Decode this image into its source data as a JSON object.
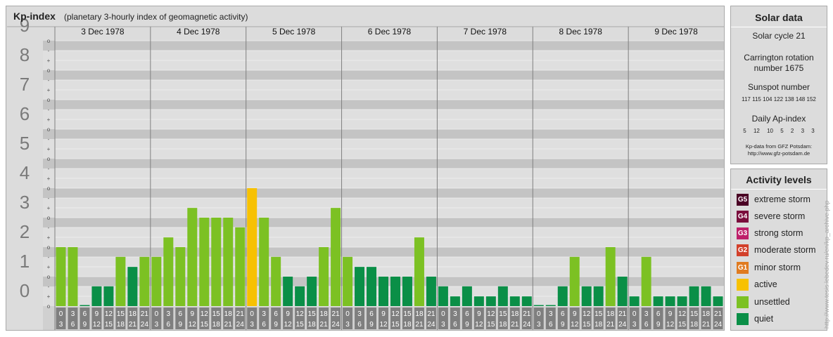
{
  "title": "Kp-index",
  "subtitle": "(planetary 3-hourly index of geomagnetic activity)",
  "chart_data": {
    "type": "bar",
    "ylim": [
      0,
      9
    ],
    "y_ticks": [
      "0",
      "1",
      "2",
      "3",
      "4",
      "5",
      "6",
      "7",
      "8",
      "9"
    ],
    "minor_tick_labels": [
      "o",
      "+",
      "-"
    ],
    "days": [
      "3 Dec 1978",
      "4 Dec 1978",
      "5 Dec 1978",
      "6 Dec 1978",
      "7 Dec 1978",
      "8 Dec 1978",
      "9 Dec 1978"
    ],
    "interval_labels": [
      [
        "0",
        "3"
      ],
      [
        "3",
        "6"
      ],
      [
        "6",
        "9"
      ],
      [
        "9",
        "12"
      ],
      [
        "12",
        "15"
      ],
      [
        "15",
        "18"
      ],
      [
        "18",
        "21"
      ],
      [
        "21",
        "24"
      ]
    ],
    "values": [
      [
        2.0,
        2.0,
        0.0,
        0.67,
        0.67,
        1.67,
        1.33,
        1.67
      ],
      [
        1.67,
        2.33,
        2.0,
        3.33,
        3.0,
        3.0,
        3.0,
        2.67
      ],
      [
        4.0,
        3.0,
        1.67,
        1.0,
        0.67,
        1.0,
        2.0,
        3.33
      ],
      [
        1.67,
        1.33,
        1.33,
        1.0,
        1.0,
        1.0,
        2.33,
        1.0
      ],
      [
        0.67,
        0.33,
        0.67,
        0.33,
        0.33,
        0.67,
        0.33,
        0.33
      ],
      [
        0.0,
        0.0,
        0.67,
        1.67,
        0.67,
        0.67,
        2.0,
        1.0
      ],
      [
        0.33,
        1.67,
        0.33,
        0.33,
        0.33,
        0.67,
        0.67,
        0.33
      ]
    ]
  },
  "colors": {
    "quiet": "#0a8f47",
    "unsettled": "#7cc123",
    "active": "#f7c102",
    "minor_storm": "#e07b20",
    "moderate_storm": "#d2402a",
    "strong_storm": "#be1f6a",
    "severe_storm": "#7a0d3c",
    "extreme_storm": "#4a0024",
    "band_dark": "#c4c4c4",
    "band_light": "#dfdfdf",
    "label_box": "#7f7f7f"
  },
  "solar": {
    "heading": "Solar data",
    "cycle": "Solar cycle 21",
    "carrington_line1": "Carrington rotation",
    "carrington_line2": "number 1675",
    "sunspot_label": "Sunspot number",
    "sunspot_values": [
      "117",
      "115",
      "104",
      "122",
      "138",
      "148",
      "152"
    ],
    "ap_label": "Daily Ap-index",
    "ap_values": [
      "5",
      "12",
      "10",
      "5",
      "2",
      "3",
      "3"
    ],
    "source_line1": "Kp-data from GFZ Potsdam:",
    "source_line2": "http://www.gfz-potsdam.de"
  },
  "legend": {
    "heading": "Activity levels",
    "items": [
      {
        "code": "G5",
        "label": "extreme storm",
        "color": "#4a0024"
      },
      {
        "code": "G4",
        "label": "severe storm",
        "color": "#7a0d3c"
      },
      {
        "code": "G3",
        "label": "strong storm",
        "color": "#be1f6a"
      },
      {
        "code": "G2",
        "label": "moderate storm",
        "color": "#d2402a"
      },
      {
        "code": "G1",
        "label": "minor storm",
        "color": "#e07b20"
      },
      {
        "code": "",
        "label": "active",
        "color": "#f7c102"
      },
      {
        "code": "",
        "label": "unsettled",
        "color": "#7cc123"
      },
      {
        "code": "",
        "label": "quiet",
        "color": "#0a8f47"
      }
    ]
  },
  "watermark": "http://www.tesis.lebedev.ru/en/kp_archive.php"
}
